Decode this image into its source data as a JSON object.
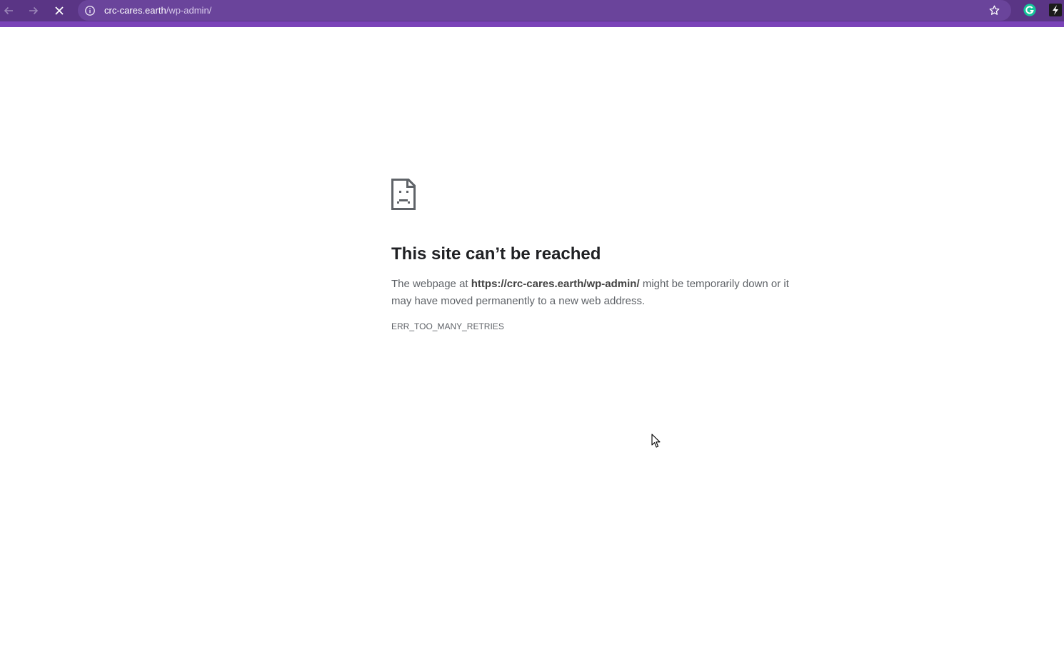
{
  "browser": {
    "toolbar_color": "#5a3585",
    "accent_color": "#7a43b8",
    "back_icon": "arrow-left-icon",
    "forward_icon": "arrow-right-icon",
    "stop_icon": "close-icon",
    "address": {
      "host": "crc-cares.earth",
      "path": "/wp-admin/",
      "info_icon": "info-circle-icon",
      "bookmark_icon": "star-outline-icon"
    },
    "extensions": [
      {
        "name": "grammarly-extension-icon"
      },
      {
        "name": "extension-bolt-icon"
      }
    ]
  },
  "error_page": {
    "icon": "sad-document-icon",
    "title": "This site can’t be reached",
    "body_prefix": "The webpage at ",
    "body_url": "https://crc-cares.earth/wp-admin/",
    "body_suffix": " might be temporarily down or it may have moved permanently to a new web address.",
    "error_code": "ERR_TOO_MANY_RETRIES"
  }
}
